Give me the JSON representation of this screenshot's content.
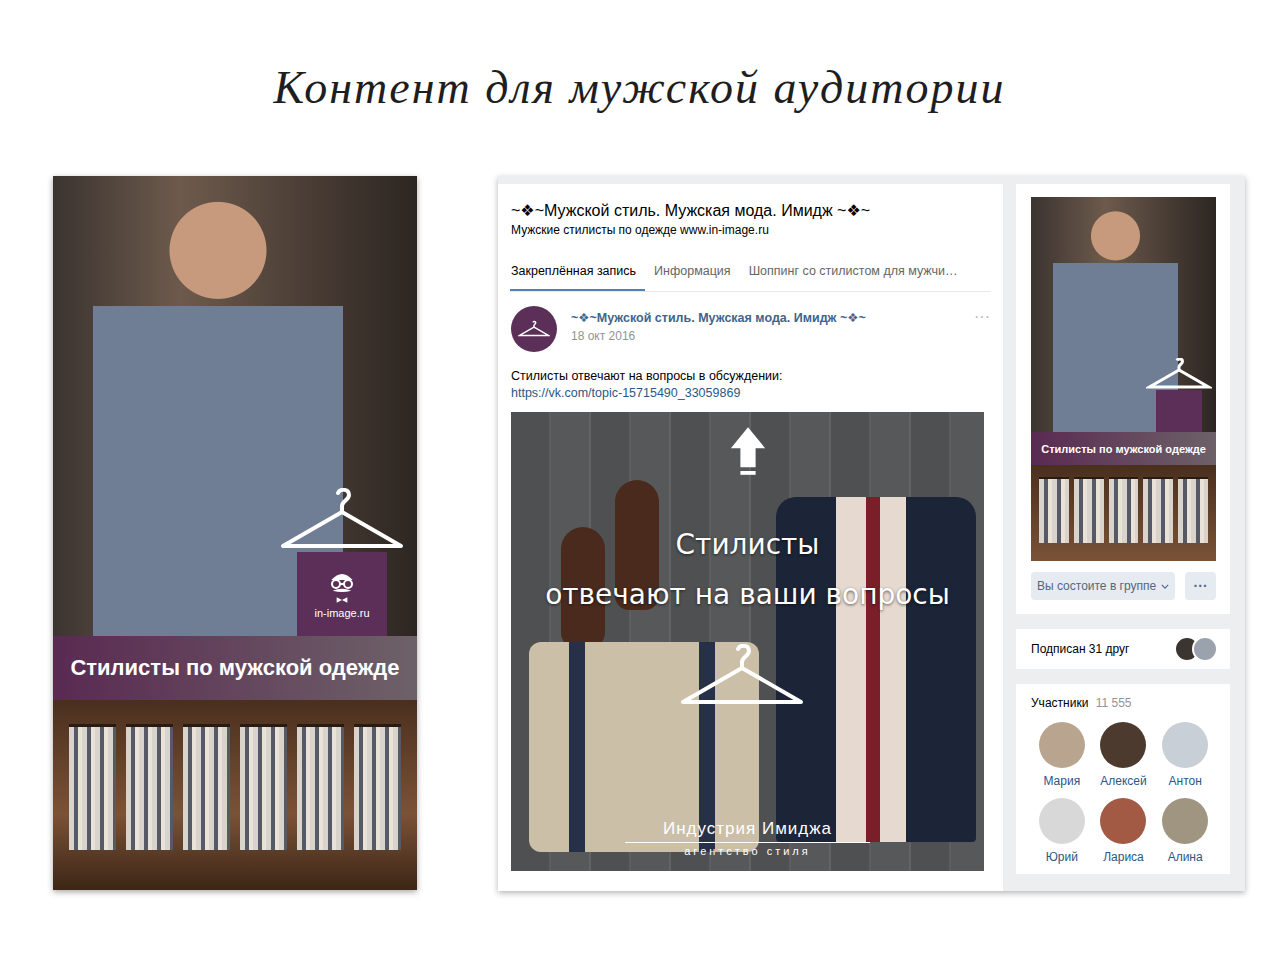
{
  "slide": {
    "title": "Контент для мужской аудитории"
  },
  "poster": {
    "caption": "Стилисты по мужской одежде",
    "site": "in-image.ru"
  },
  "group": {
    "title": "~❖~Мужской стиль. Мужская мода. Имидж ~❖~",
    "status": "Мужские стилисты по одежде www.in-image.ru"
  },
  "tabs": [
    {
      "label": "Закреплённая запись",
      "selected": true
    },
    {
      "label": "Информация",
      "selected": false
    },
    {
      "label": "Шоппинг со стилистом для мужчи…",
      "selected": false
    }
  ],
  "post": {
    "author": "~❖~Мужской стиль. Мужская мода. Имидж ~❖~",
    "date": "18 окт 2016",
    "menu": "···",
    "text": "Стилисты отвечают на вопросы в обсуждении:",
    "link": "https://vk.com/topic-15715490_33059869",
    "image": {
      "headline": [
        "Стилисты",
        "отвечают на ваши вопросы"
      ],
      "brand": "Индустрия Имиджа",
      "brand_sub": "агентство стиля"
    }
  },
  "sidebar": {
    "membership_button": "Вы состоите в группе",
    "more_button": "···",
    "friends": "Подписан 31 друг",
    "members": {
      "title": "Участники",
      "count": "11 555",
      "items": [
        {
          "name": "Мария"
        },
        {
          "name": "Алексей"
        },
        {
          "name": "Антон"
        },
        {
          "name": "Юрий"
        },
        {
          "name": "Лариса"
        },
        {
          "name": "Алина"
        }
      ]
    }
  }
}
